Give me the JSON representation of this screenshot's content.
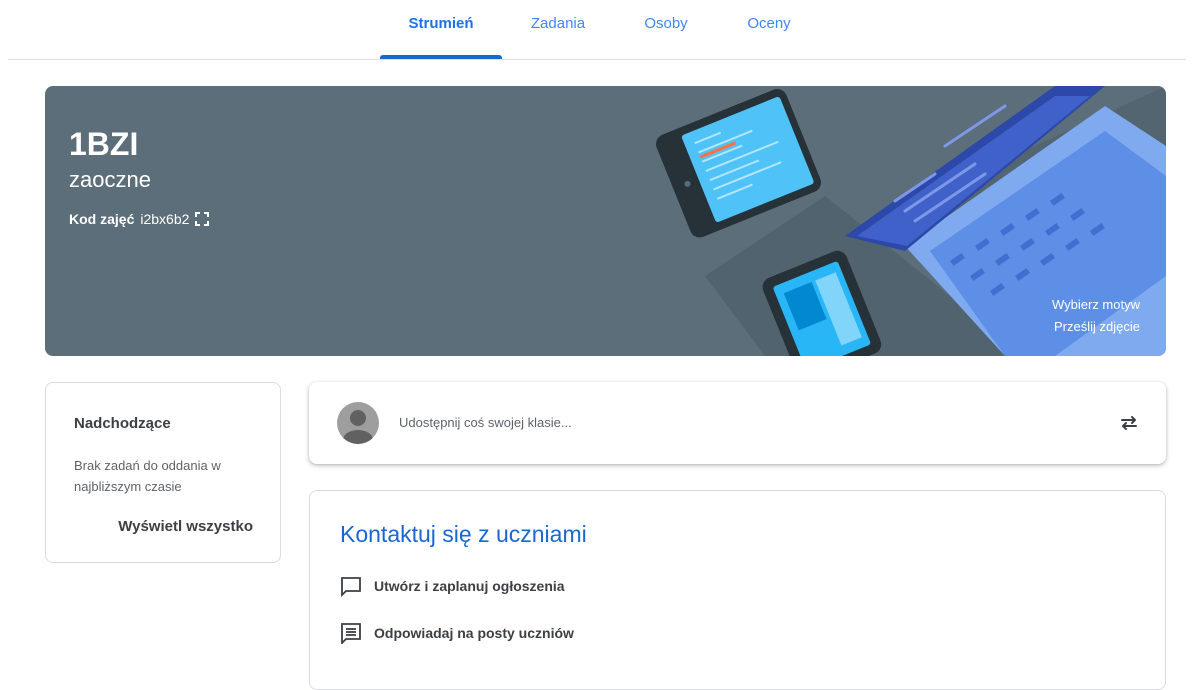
{
  "tabs": [
    {
      "label": "Strumień",
      "active": true
    },
    {
      "label": "Zadania",
      "active": false
    },
    {
      "label": "Osoby",
      "active": false
    },
    {
      "label": "Oceny",
      "active": false
    }
  ],
  "banner": {
    "title": "1BZI",
    "subtitle": "zaoczne",
    "code_label": "Kod zajęć",
    "code_value": "i2bx6b2",
    "code_icon": "fullscreen-icon",
    "select_theme": "Wybierz motyw",
    "upload_photo": "Prześlij zdjęcie",
    "background_color": "#5b6e7a"
  },
  "upcoming": {
    "title": "Nadchodzące",
    "text": "Brak zadań do oddania w najbliższym czasie",
    "view_all": "Wyświetl wszystko"
  },
  "share": {
    "placeholder": "Udostępnij coś swojej klasie...",
    "repost_icon": "repost-icon"
  },
  "contact": {
    "title": "Kontaktuj się z uczniami",
    "items": [
      {
        "label": "Utwórz i zaplanuj ogłoszenia",
        "icon": "announcement-icon"
      },
      {
        "label": "Odpowiadaj na posty uczniów",
        "icon": "reply-posts-icon"
      }
    ]
  },
  "colors": {
    "accent": "#1967d2",
    "tab_inactive": "#4285f4"
  }
}
